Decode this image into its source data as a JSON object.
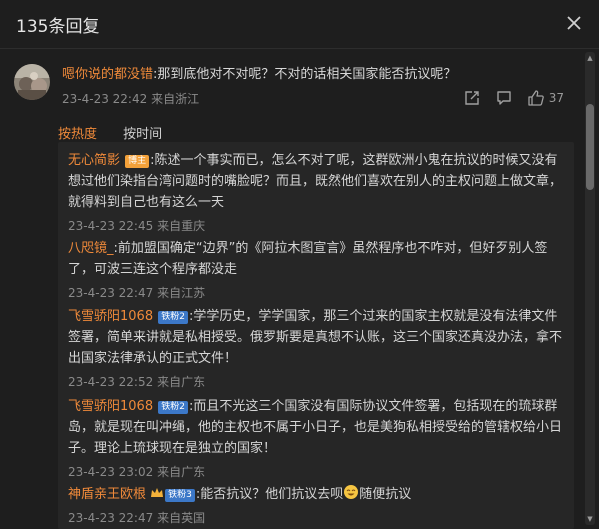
{
  "header": {
    "title": "135条回复"
  },
  "main_comment": {
    "username": "嗯你说的都没错",
    "text": ":那到底他对不对呢？不对的话相关国家能否抗议呢？",
    "time": "23-4-23 22:42",
    "location": "来自浙江",
    "like_count": "37"
  },
  "sort": {
    "hot": "按热度",
    "time": "按时间"
  },
  "replies": [
    {
      "username": "无心简影",
      "badge": "博主",
      "text": ":陈述一个事实而已，怎么不对了呢，这群欧洲小鬼在抗议的时候又没有想过他们染指台湾问题时的嘴脸呢？而且，既然他们喜欢在别人的主权问题上做文章，就得料到自己也有这么一天",
      "time": "23-4-23 22:45",
      "location": "来自重庆"
    },
    {
      "username": "八咫镜_",
      "badge": "",
      "text": ":前加盟国确定“边界”的《阿拉木图宣言》虽然程序也不咋对，但好歹别人签了，可波三连这个程序都没走",
      "time": "23-4-23 22:47",
      "location": "来自江苏"
    },
    {
      "username": "飞雪骄阳1068",
      "badge": "铁粉2",
      "text": ":学学历史，学学国家，那三个过来的国家主权就是没有法律文件签署，简单来讲就是私相授受。俄罗斯要是真想不认账，这三个国家还真没办法，拿不出国家法律承认的正式文件！",
      "time": "23-4-23 22:52",
      "location": "来自广东"
    },
    {
      "username": "飞雪骄阳1068",
      "badge": "铁粉2",
      "text": ":而且不光这三个国家没有国际协议文件签署，包括现在的琉球群岛，就是现在叫冲绳，他的主权也不属于小日子，也是美狗私相授受给的管辖权给小日子。理论上琉球现在是独立的国家！",
      "time": "23-4-23 23:02",
      "location": "来自广东"
    },
    {
      "username": "神盾亲王欧根",
      "badge": "铁粉3",
      "text_before": ":能否抗议？他们抗议去呗",
      "text_after": "随便抗议",
      "time": "23-4-23 22:47",
      "location": "来自英国"
    }
  ],
  "colors": {
    "accent": "#f08a3a",
    "background": "#1e1e1e",
    "reply_bg": "#262626"
  }
}
